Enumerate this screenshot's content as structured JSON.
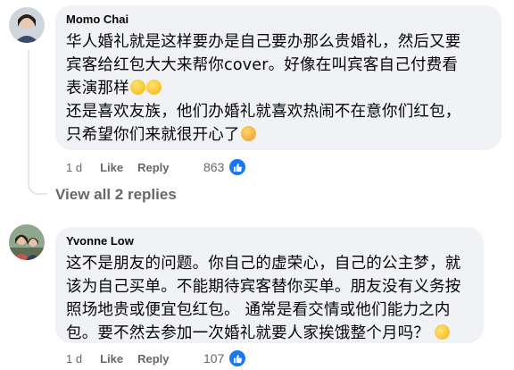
{
  "comments": [
    {
      "author": "Momo Chai",
      "lines": [
        "华人婚礼就是这样要办是自己要办那么贵婚礼，然后又要",
        "宾客给红包大大来帮你cover。好像在叫宾客自己付费看",
        "表演那样",
        "还是喜欢友族，他们办婚礼就喜欢热闹不在意你们红包，",
        "只希望你们来就很开心了"
      ],
      "time": "1 d",
      "like_label": "Like",
      "reply_label": "Reply",
      "reaction_count": "863"
    },
    {
      "author": "Yvonne Low",
      "lines": [
        "这不是朋友的问题。你自己的虚荣心，自己的公主梦，就",
        "该为自己买单。不能期待宾客替你买单。朋友没有义务按",
        "照场地贵或便宜包红包。 通常是看交情或他们能力之内",
        "包。要不然去参加一次婚礼就要人家挨饿整个月吗？"
      ],
      "time": "1 d",
      "like_label": "Like",
      "reply_label": "Reply",
      "reaction_count": "107"
    }
  ],
  "view_replies_label": "View all 2 replies",
  "colors": {
    "bubble": "#f0f2f5",
    "meta": "#65676b",
    "like_blue": "#1877f2"
  },
  "icons": [
    "grinning-sweat-emoji",
    "tired-face-emoji",
    "rolling-laughing-emoji",
    "like-thumb-icon"
  ]
}
